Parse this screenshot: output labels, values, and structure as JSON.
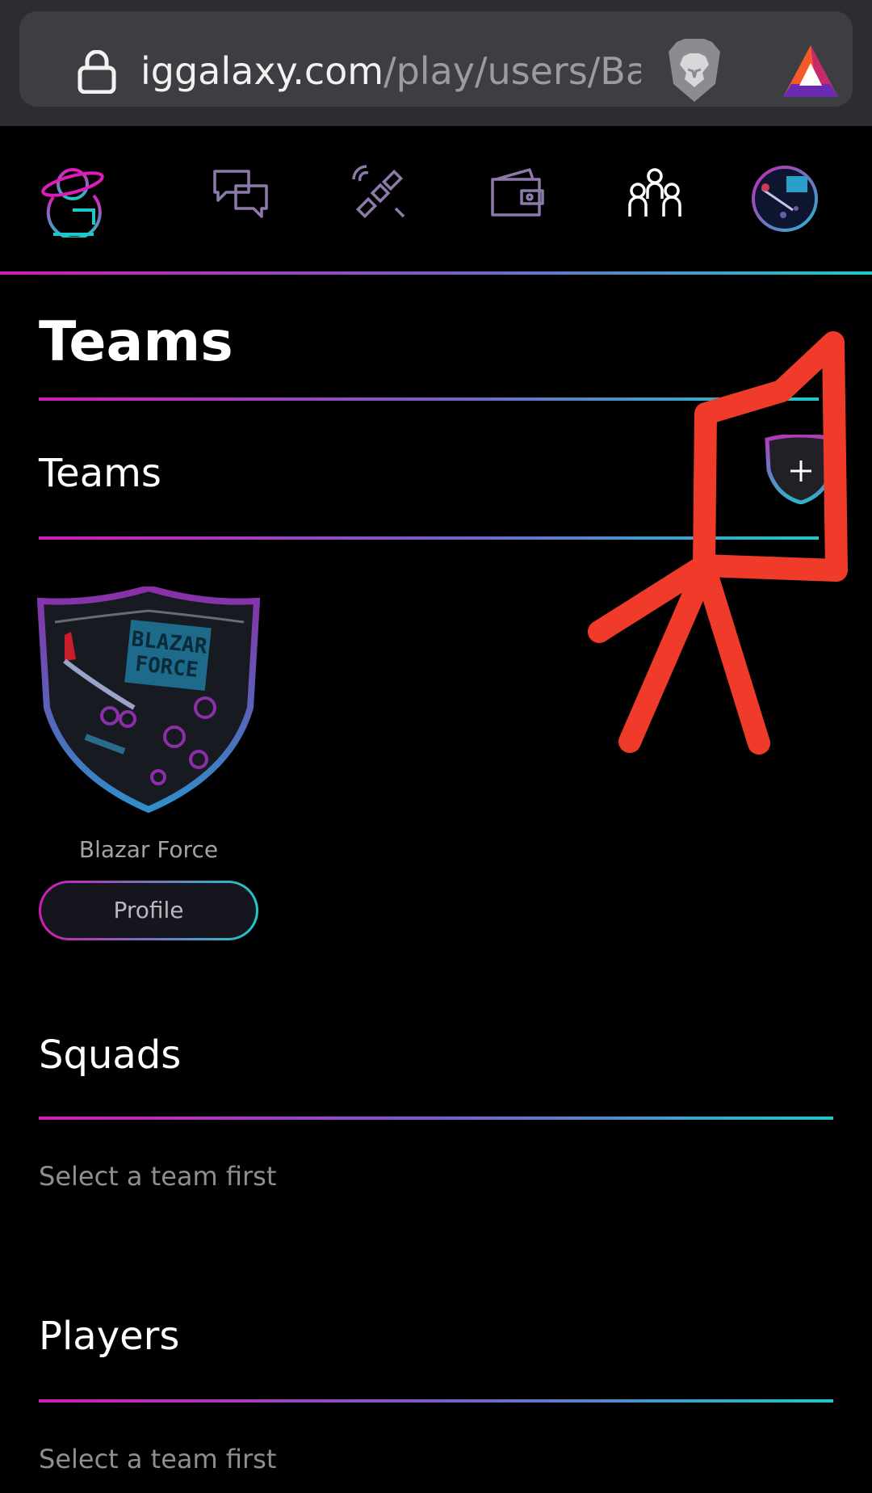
{
  "browser": {
    "url_domain": "iggalaxy.com",
    "url_path": "/play/users/Bar"
  },
  "nav": {
    "items": [
      {
        "icon": "galaxy-logo-icon"
      },
      {
        "icon": "chat-icon"
      },
      {
        "icon": "satellite-icon"
      },
      {
        "icon": "wallet-icon"
      },
      {
        "icon": "community-icon"
      },
      {
        "icon": "team-avatar-icon"
      }
    ]
  },
  "page": {
    "title": "Teams"
  },
  "teams_section": {
    "title": "Teams",
    "add_icon": "shield-plus-icon",
    "teams": [
      {
        "name": "Blazar Force",
        "crest_text_line1": "BLAZAR",
        "crest_text_line2": "FORCE",
        "profile_label": "Profile"
      }
    ]
  },
  "squads_section": {
    "title": "Squads",
    "hint": "Select a team first"
  },
  "players_section": {
    "title": "Players",
    "hint": "Select a team first"
  },
  "colors": {
    "gradient_start": "#d21bb2",
    "gradient_end": "#1ec8c8",
    "annotation_red": "#f03a2a"
  }
}
